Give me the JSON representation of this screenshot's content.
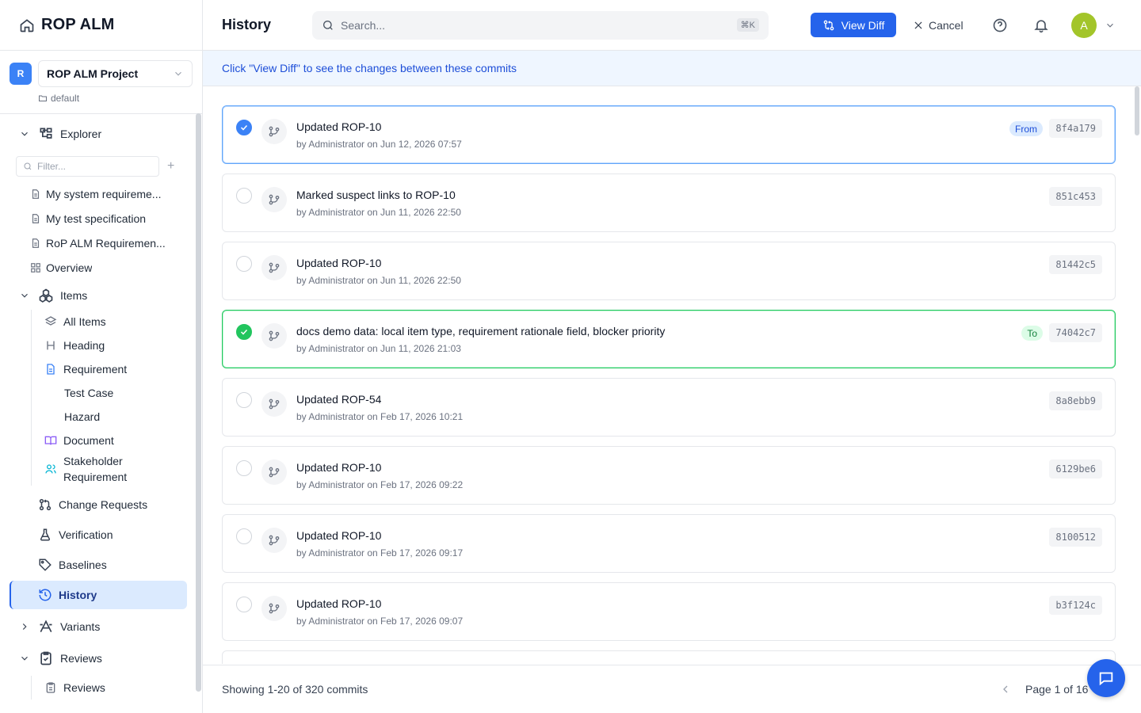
{
  "app": {
    "name": "ROP ALM"
  },
  "project": {
    "badge": "R",
    "name": "ROP ALM Project",
    "branch": "default"
  },
  "sidebar": {
    "explorer_label": "Explorer",
    "filter_placeholder": "Filter...",
    "documents": [
      {
        "label": "My system requireme..."
      },
      {
        "label": "My test specification"
      },
      {
        "label": "RoP ALM Requiremen..."
      },
      {
        "label": "Overview"
      }
    ],
    "items_label": "Items",
    "item_types": [
      {
        "label": "All Items"
      },
      {
        "label": "Heading"
      },
      {
        "label": "Requirement"
      },
      {
        "label": "Test Case"
      },
      {
        "label": "Hazard"
      },
      {
        "label": "Document"
      },
      {
        "label": "Stakeholder Requirement"
      }
    ],
    "nav": [
      {
        "label": "Change Requests"
      },
      {
        "label": "Verification"
      },
      {
        "label": "Baselines"
      },
      {
        "label": "History"
      }
    ],
    "variants_label": "Variants",
    "reviews_label": "Reviews",
    "reviews_sub": [
      {
        "label": "Reviews"
      }
    ]
  },
  "header": {
    "title": "History",
    "search_placeholder": "Search...",
    "search_shortcut": "⌘K",
    "view_diff_label": "View Diff",
    "cancel_label": "Cancel",
    "avatar_initial": "A"
  },
  "banner": {
    "text": "Click \"View Diff\" to see the changes between these commits"
  },
  "commits": [
    {
      "message": "Updated ROP-10",
      "meta": "by Administrator on Jun 12, 2026 07:57",
      "hash": "8f4a179",
      "tag": "From"
    },
    {
      "message": "Marked suspect links to ROP-10",
      "meta": "by Administrator on Jun 11, 2026 22:50",
      "hash": "851c453",
      "tag": ""
    },
    {
      "message": "Updated ROP-10",
      "meta": "by Administrator on Jun 11, 2026 22:50",
      "hash": "81442c5",
      "tag": ""
    },
    {
      "message": "docs demo data: local item type, requirement rationale field, blocker priority",
      "meta": "by Administrator on Jun 11, 2026 21:03",
      "hash": "74042c7",
      "tag": "To"
    },
    {
      "message": "Updated ROP-54",
      "meta": "by Administrator on Feb 17, 2026 10:21",
      "hash": "8a8ebb9",
      "tag": ""
    },
    {
      "message": "Updated ROP-10",
      "meta": "by Administrator on Feb 17, 2026 09:22",
      "hash": "6129be6",
      "tag": ""
    },
    {
      "message": "Updated ROP-10",
      "meta": "by Administrator on Feb 17, 2026 09:17",
      "hash": "8100512",
      "tag": ""
    },
    {
      "message": "Updated ROP-10",
      "meta": "by Administrator on Feb 17, 2026 09:07",
      "hash": "b3f124c",
      "tag": ""
    }
  ],
  "footer": {
    "count_text": "Showing 1-20 of 320 commits",
    "page_text": "Page 1 of 16"
  },
  "colors": {
    "primary": "#2563eb",
    "from_border": "#60a5fa",
    "to_border": "#22c55e",
    "avatar": "#a3c52a"
  }
}
